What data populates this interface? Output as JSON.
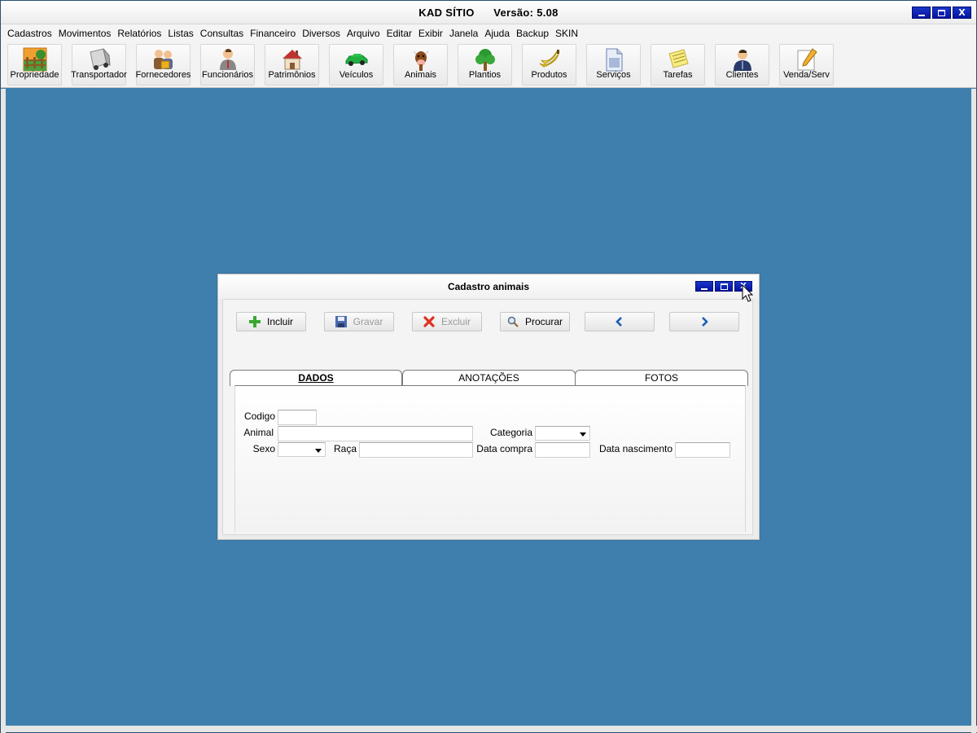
{
  "app": {
    "title": "KAD SÍTIO",
    "version_label": "Versão: 5.08"
  },
  "window_controls": {
    "minimize": "–",
    "maximize": "□",
    "close": "X"
  },
  "menu": [
    "Cadastros",
    "Movimentos",
    "Relatórios",
    "Listas",
    "Consultas",
    "Financeiro",
    "Diversos",
    "Arquivo",
    "Editar",
    "Exibir",
    "Janela",
    "Ajuda",
    "Backup",
    "SKIN"
  ],
  "toolbar": [
    {
      "label": "Propriedade",
      "icon": "farm-fence-icon"
    },
    {
      "label": "Transportador",
      "icon": "truck-icon"
    },
    {
      "label": "Fornecedores",
      "icon": "suppliers-icon"
    },
    {
      "label": "Funcionários",
      "icon": "employee-icon"
    },
    {
      "label": "Patrimônios",
      "icon": "house-icon"
    },
    {
      "label": "Veículos",
      "icon": "car-icon"
    },
    {
      "label": "Animais",
      "icon": "cow-icon"
    },
    {
      "label": "Plantios",
      "icon": "tree-icon"
    },
    {
      "label": "Produtos",
      "icon": "banana-icon"
    },
    {
      "label": "Serviços",
      "icon": "document-icon"
    },
    {
      "label": "Tarefas",
      "icon": "notepad-icon"
    },
    {
      "label": "Clientes",
      "icon": "client-icon"
    },
    {
      "label": "Venda/Serv",
      "icon": "pencil-paper-icon"
    }
  ],
  "dialog": {
    "title": "Cadastro animais",
    "actions": {
      "incluir": "Incluir",
      "gravar": "Gravar",
      "excluir": "Excluir",
      "procurar": "Procurar"
    },
    "tabs": [
      "DADOS",
      "ANOTAÇÕES",
      "FOTOS"
    ],
    "active_tab": "DADOS",
    "form": {
      "codigo_label": "Codigo",
      "codigo_value": "",
      "animal_label": "Animal",
      "animal_value": "",
      "categoria_label": "Categoria",
      "categoria_value": "",
      "sexo_label": "Sexo",
      "sexo_value": "",
      "raca_label": "Raça",
      "raca_value": "",
      "data_compra_label": "Data compra",
      "data_compra_value": "",
      "data_nascimento_label": "Data nascimento",
      "data_nascimento_value": ""
    }
  },
  "colors": {
    "desktop": "#3f7fae",
    "window_button": "#0a1fb0",
    "accent_arrow": "#1a5fb4"
  }
}
